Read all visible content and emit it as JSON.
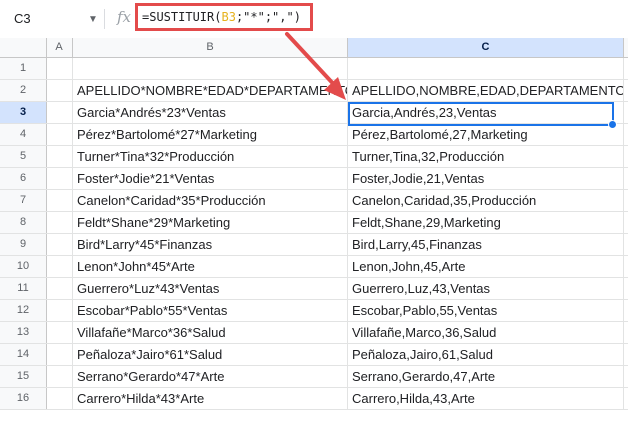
{
  "namebox": {
    "value": "C3"
  },
  "formula_bar": {
    "prefix": "=SUSTITUIR(",
    "ref": "B3",
    "rest": ";\"*\";\",\")"
  },
  "columns": [
    "A",
    "B",
    "C"
  ],
  "selected_column": "C",
  "selected_row": "3",
  "rows": [
    {
      "num": "1",
      "b": "",
      "c": ""
    },
    {
      "num": "2",
      "b": "APELLIDO*NOMBRE*EDAD*DEPARTAMENTO",
      "c": "APELLIDO,NOMBRE,EDAD,DEPARTAMENTO"
    },
    {
      "num": "3",
      "b": "Garcia*Andrés*23*Ventas",
      "c": "Garcia,Andrés,23,Ventas"
    },
    {
      "num": "4",
      "b": "Pérez*Bartolomé*27*Marketing",
      "c": "Pérez,Bartolomé,27,Marketing"
    },
    {
      "num": "5",
      "b": "Turner*Tina*32*Producción",
      "c": "Turner,Tina,32,Producción"
    },
    {
      "num": "6",
      "b": "Foster*Jodie*21*Ventas",
      "c": "Foster,Jodie,21,Ventas"
    },
    {
      "num": "7",
      "b": "Canelon*Caridad*35*Producción",
      "c": "Canelon,Caridad,35,Producción"
    },
    {
      "num": "8",
      "b": "Feldt*Shane*29*Marketing",
      "c": "Feldt,Shane,29,Marketing"
    },
    {
      "num": "9",
      "b": "Bird*Larry*45*Finanzas",
      "c": "Bird,Larry,45,Finanzas"
    },
    {
      "num": "10",
      "b": "Lenon*John*45*Arte",
      "c": "Lenon,John,45,Arte"
    },
    {
      "num": "11",
      "b": "Guerrero*Luz*43*Ventas",
      "c": "Guerrero,Luz,43,Ventas"
    },
    {
      "num": "12",
      "b": "Escobar*Pablo*55*Ventas",
      "c": "Escobar,Pablo,55,Ventas"
    },
    {
      "num": "13",
      "b": "Villafañe*Marco*36*Salud",
      "c": "Villafañe,Marco,36,Salud"
    },
    {
      "num": "14",
      "b": "Peñaloza*Jairo*61*Salud",
      "c": "Peñaloza,Jairo,61,Salud"
    },
    {
      "num": "15",
      "b": "Serrano*Gerardo*47*Arte",
      "c": "Serrano,Gerardo,47,Arte"
    },
    {
      "num": "16",
      "b": "Carrero*Hilda*43*Arte",
      "c": "Carrero,Hilda,43,Arte"
    }
  ],
  "colors": {
    "highlight_red": "#e34b4b",
    "selection_blue": "#1a73e8",
    "ref_yellow": "#e6b21d"
  },
  "icons": {
    "fx": "fx-icon",
    "dropdown": "caret-down-icon"
  }
}
